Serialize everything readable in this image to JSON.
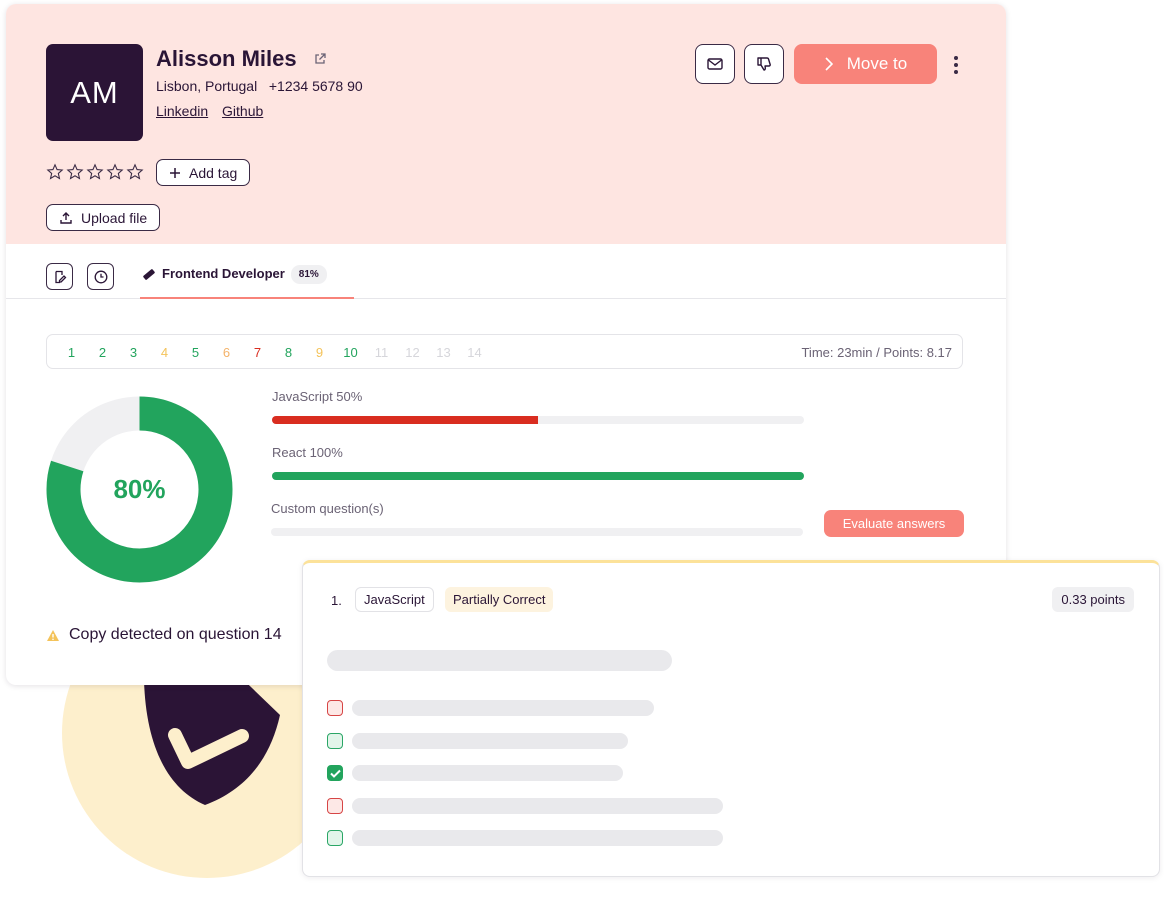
{
  "candidate": {
    "initials": "AM",
    "name": "Alisson Miles",
    "location": "Lisbon, Portugal",
    "phone": "+1234 5678 90",
    "links": [
      "Linkedin",
      "Github"
    ],
    "rating": 0,
    "rating_max": 5
  },
  "actions": {
    "add_tag": "Add tag",
    "upload_file": "Upload file",
    "move_to": "Move to"
  },
  "tabs": {
    "active_label": "Frontend Developer",
    "active_score": "81%"
  },
  "questions": {
    "numbers": [
      {
        "n": "1",
        "color": "#22a45d"
      },
      {
        "n": "2",
        "color": "#22a45d"
      },
      {
        "n": "3",
        "color": "#22a45d"
      },
      {
        "n": "4",
        "color": "#f4c35a"
      },
      {
        "n": "5",
        "color": "#22a45d"
      },
      {
        "n": "6",
        "color": "#f4b36a"
      },
      {
        "n": "7",
        "color": "#d92d20"
      },
      {
        "n": "8",
        "color": "#22a45d"
      },
      {
        "n": "9",
        "color": "#f4c35a"
      },
      {
        "n": "10",
        "color": "#22a45d"
      },
      {
        "n": "11",
        "color": "#d6d6db"
      },
      {
        "n": "12",
        "color": "#d6d6db"
      },
      {
        "n": "13",
        "color": "#d6d6db"
      },
      {
        "n": "14",
        "color": "#d6d6db"
      }
    ],
    "summary": "Time: 23min / Points: 8.17"
  },
  "score": {
    "value": "80%",
    "fraction": 0.8,
    "color": "#22a45d"
  },
  "skills": [
    {
      "label": "JavaScript 50%",
      "fraction": 0.5,
      "color": "#d92d20"
    },
    {
      "label": "React 100%",
      "fraction": 1.0,
      "color": "#22a45d"
    },
    {
      "label": "Custom question(s)",
      "fraction": 0,
      "color": "#f0f0f2"
    }
  ],
  "evaluate_label": "Evaluate answers",
  "warning": "Copy detected on question 14",
  "answer": {
    "number": "1.",
    "tag": "JavaScript",
    "status": "Partially Correct",
    "points": "0.33 points",
    "options": [
      {
        "state": "wrong"
      },
      {
        "state": "right"
      },
      {
        "state": "checked"
      },
      {
        "state": "wrong"
      },
      {
        "state": "right"
      }
    ]
  }
}
